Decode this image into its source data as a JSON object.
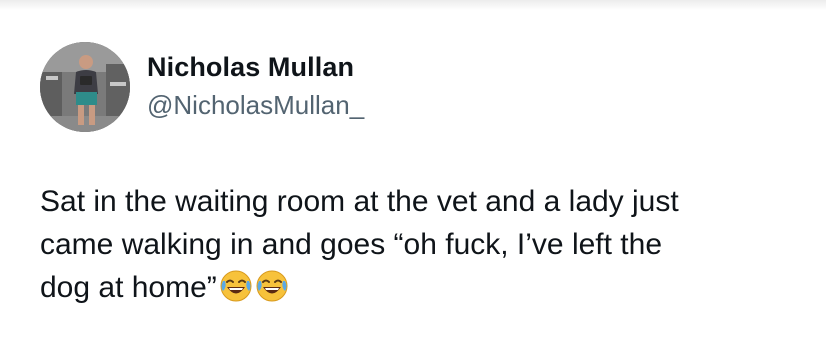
{
  "author": {
    "display_name": "Nicholas Mullan",
    "handle": "@NicholasMullan_"
  },
  "tweet": {
    "line1": "Sat in the waiting room at the vet and a lady just",
    "line2": "came walking in and goes “oh fuck, I’ve left the",
    "line3": "dog at home”",
    "emojis": [
      "face-with-tears-of-joy-icon",
      "face-with-tears-of-joy-icon"
    ]
  },
  "colors": {
    "text": "#0f1419",
    "secondary_text": "#536471",
    "background": "#ffffff",
    "emoji_face": "#f7c23b",
    "emoji_tears": "#5aa9e6"
  }
}
